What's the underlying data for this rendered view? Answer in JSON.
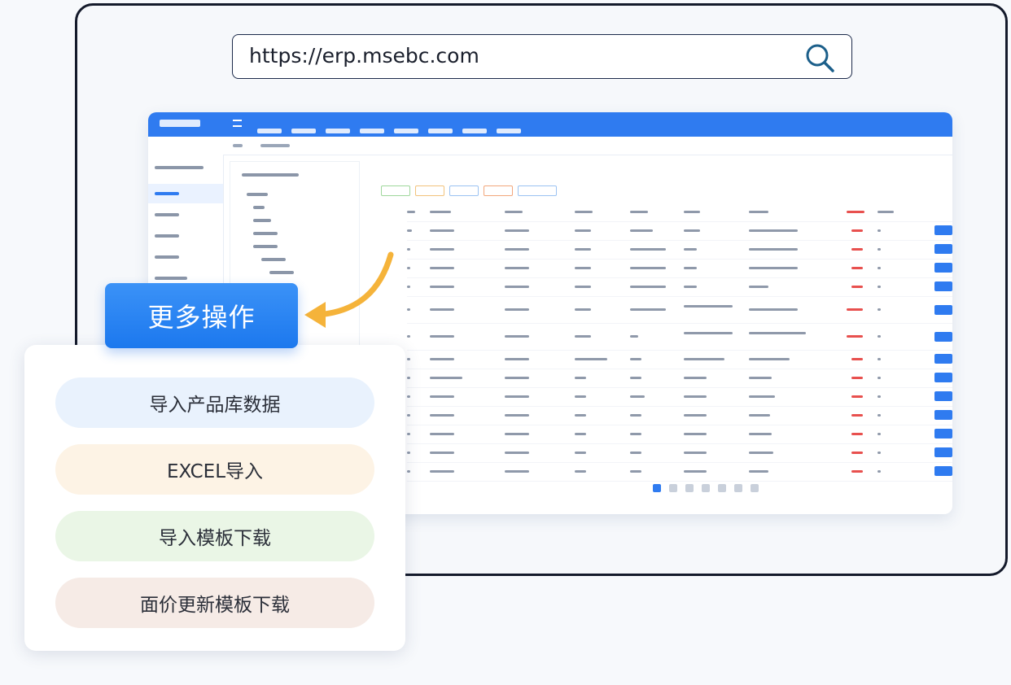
{
  "address_bar": {
    "url": "https://erp.msebc.com",
    "search_icon": "search-icon"
  },
  "more_actions": {
    "label": "更多操作"
  },
  "dropdown_menu": {
    "items": [
      {
        "label": "导入产品库数据",
        "color": "#e9f2fd"
      },
      {
        "label": "EXCEL导入",
        "color": "#fdf3e5"
      },
      {
        "label": "导入模板下载",
        "color": "#eaf6e6"
      },
      {
        "label": "面价更新模板下载",
        "color": "#f6ebe6"
      }
    ]
  },
  "colors": {
    "accent": "#2f7bf0",
    "arrow": "#f5b33a",
    "frame_border": "#141a2b"
  }
}
